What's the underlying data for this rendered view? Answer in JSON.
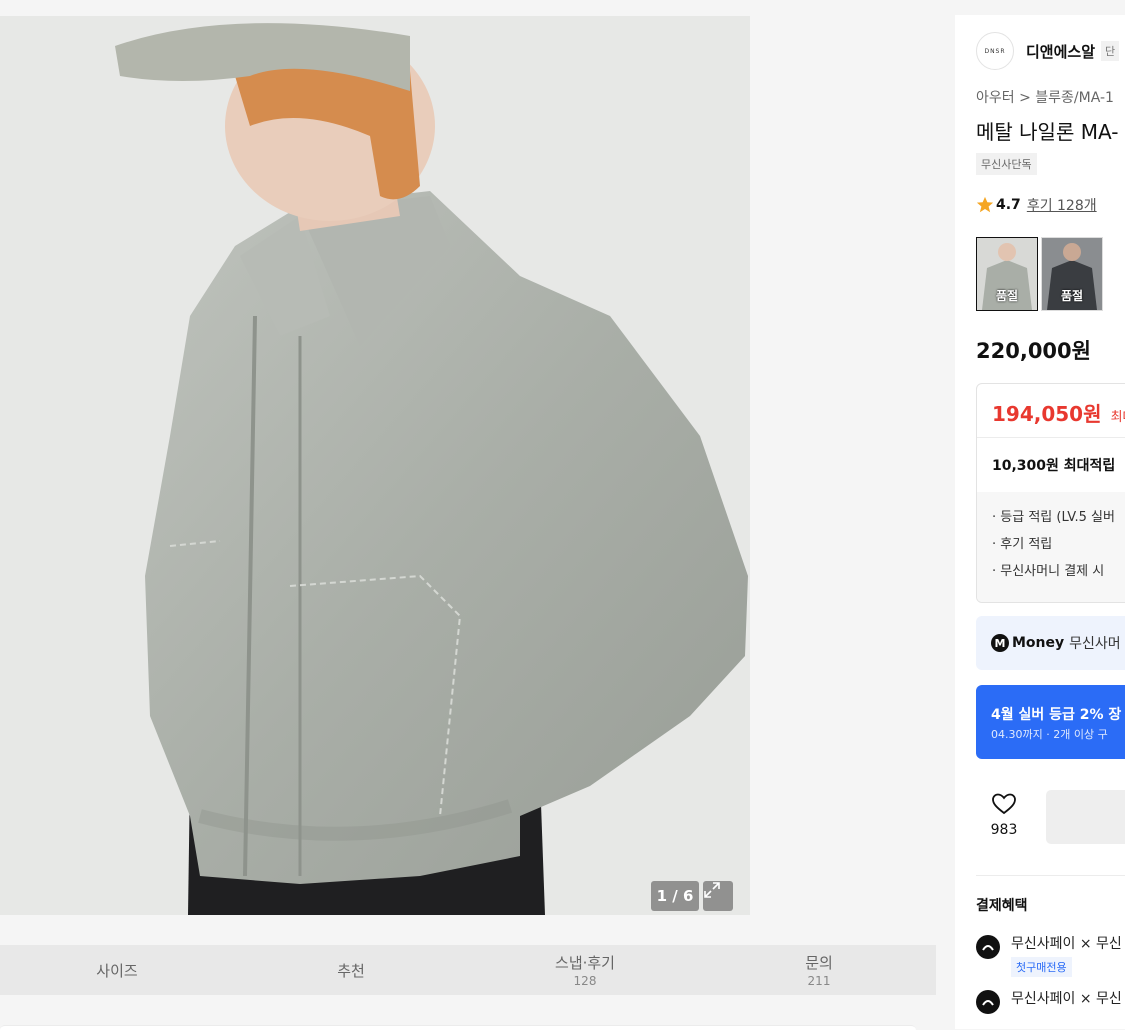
{
  "gallery": {
    "counter": "1 / 6"
  },
  "tabs": [
    {
      "label": "사이즈",
      "count": ""
    },
    {
      "label": "추천",
      "count": ""
    },
    {
      "label": "스냅·후기",
      "count": "128"
    },
    {
      "label": "문의",
      "count": "211"
    }
  ],
  "brand": {
    "logo_text": "DNSR",
    "name": "디앤에스알",
    "tag": "단"
  },
  "breadcrumb": "아우터 > 블루종/MA-1",
  "product": {
    "title": "메탈 나일론 MA-",
    "exclusive_badge": "무신사단독",
    "rating": "4.7",
    "review_link": "후기 128개",
    "thumb_soldout_1": "품절",
    "thumb_soldout_2": "품절",
    "price": "220,000원"
  },
  "benefits": {
    "sale_price": "194,050원",
    "sale_label": "최대",
    "points": "10,300원 최대적립",
    "items": [
      "· 등급 적립 (LV.5 실버",
      "· 후기 적립",
      "· 무신사머니 결제 시"
    ]
  },
  "money": {
    "logo": "M",
    "label": "Money",
    "desc": "무신사머"
  },
  "promo": {
    "title": "4월 실버 등급 2% 장",
    "sub": "04.30까지 · 2개 이상 구"
  },
  "like": {
    "count": "983"
  },
  "payment": {
    "title": "결제혜택",
    "rows": [
      {
        "text": "무신사페이 × 무신",
        "tag": "첫구매전용"
      },
      {
        "text": "무신사페이 × 무신",
        "tag": ""
      }
    ]
  },
  "colors": {
    "accent_red": "#e8382f",
    "accent_blue": "#2b6cf6",
    "star": "#f5a623"
  }
}
